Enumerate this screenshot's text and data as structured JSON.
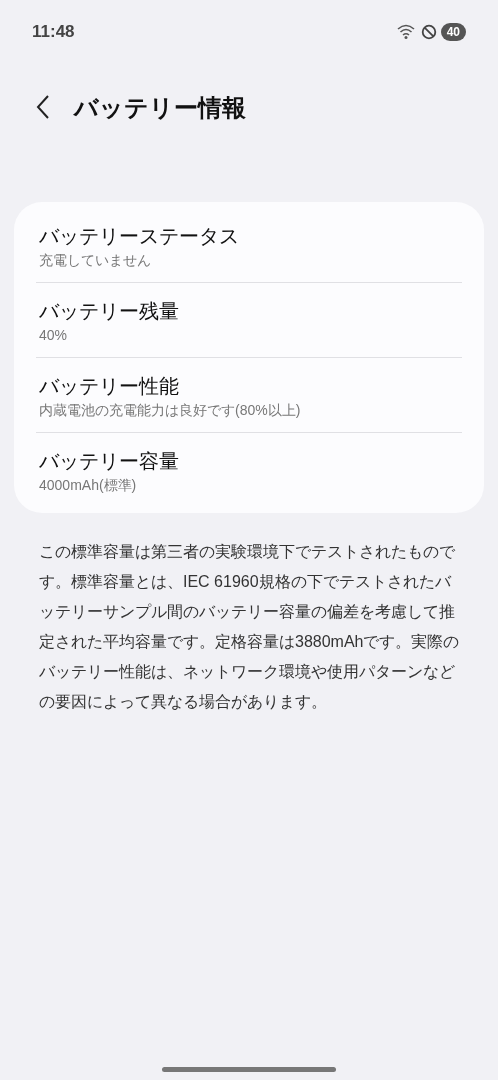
{
  "status_bar": {
    "time": "11:48",
    "battery": "40"
  },
  "header": {
    "title": "バッテリー情報"
  },
  "items": [
    {
      "title": "バッテリーステータス",
      "value": "充電していません"
    },
    {
      "title": "バッテリー残量",
      "value": "40%"
    },
    {
      "title": "バッテリー性能",
      "value": "内蔵電池の充電能力は良好です(80%以上)"
    },
    {
      "title": "バッテリー容量",
      "value": "4000mAh(標準)"
    }
  ],
  "note": "この標準容量は第三者の実験環境下でテストされたものです。標準容量とは、IEC 61960規格の下でテストされたバッテリーサンプル間のバッテリー容量の偏差を考慮して推定された平均容量です。定格容量は3880mAhです。実際のバッテリー性能は、ネットワーク環境や使用パターンなどの要因によって異なる場合があります。"
}
